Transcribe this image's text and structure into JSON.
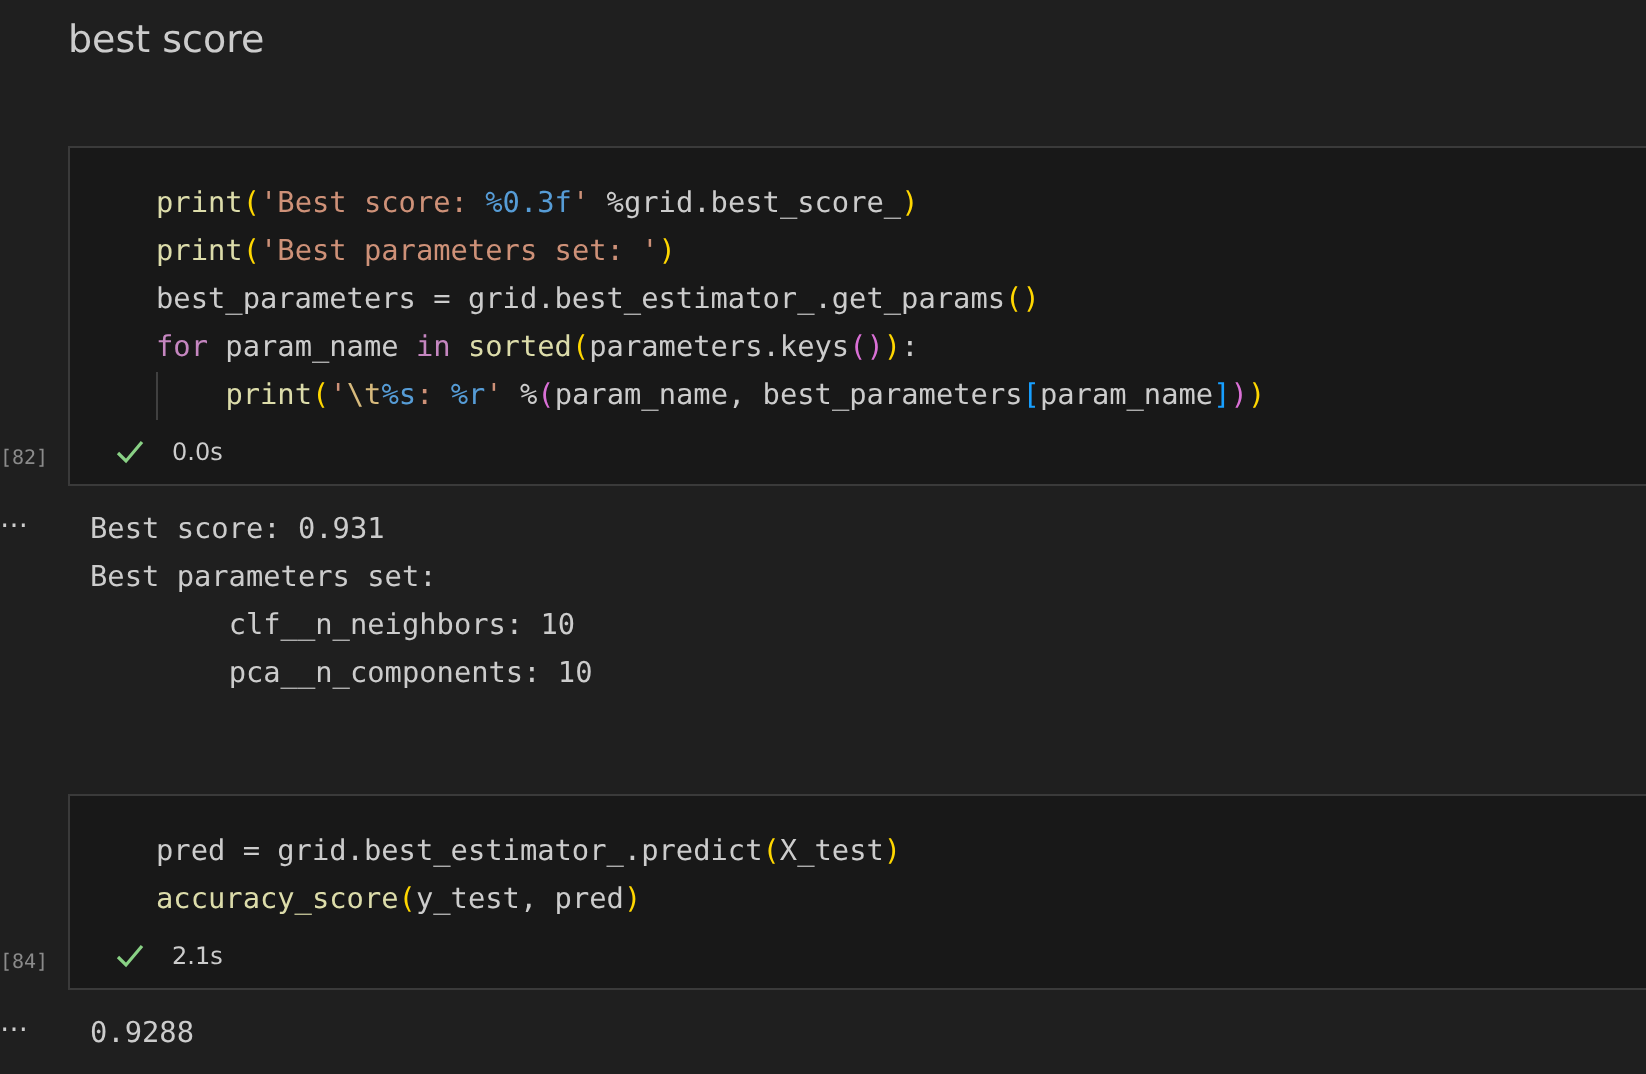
{
  "heading": "best score",
  "cells": [
    {
      "execution_count": "[82]",
      "succeeded": true,
      "duration": "0.0s",
      "output_menu": "⋯",
      "code": [
        {
          "indented": false,
          "tokens": [
            {
              "t": "print",
              "kind": "fn"
            },
            {
              "t": "(",
              "kind": "b1"
            },
            {
              "t": "'Best score: ",
              "kind": "str"
            },
            {
              "t": "%0.3f",
              "kind": "fmt"
            },
            {
              "t": "'",
              "kind": "str"
            },
            {
              "t": " %grid.best_score_",
              "kind": "p"
            },
            {
              "t": ")",
              "kind": "b1"
            }
          ]
        },
        {
          "indented": false,
          "tokens": [
            {
              "t": "print",
              "kind": "fn"
            },
            {
              "t": "(",
              "kind": "b1"
            },
            {
              "t": "'Best parameters set: '",
              "kind": "str"
            },
            {
              "t": ")",
              "kind": "b1"
            }
          ]
        },
        {
          "indented": false,
          "tokens": [
            {
              "t": "best_parameters = grid.best_estimator_.get_params",
              "kind": "p"
            },
            {
              "t": "()",
              "kind": "b1"
            }
          ]
        },
        {
          "indented": false,
          "tokens": [
            {
              "t": "for",
              "kind": "kw"
            },
            {
              "t": " param_name ",
              "kind": "p"
            },
            {
              "t": "in",
              "kind": "kw"
            },
            {
              "t": " sorted",
              "kind": "fn"
            },
            {
              "t": "(",
              "kind": "b1"
            },
            {
              "t": "parameters.keys",
              "kind": "p"
            },
            {
              "t": "()",
              "kind": "b2"
            },
            {
              "t": ")",
              "kind": "b1"
            },
            {
              "t": ":",
              "kind": "p"
            }
          ]
        },
        {
          "indented": true,
          "tokens": [
            {
              "t": "print",
              "kind": "fn"
            },
            {
              "t": "(",
              "kind": "b1"
            },
            {
              "t": "'",
              "kind": "str"
            },
            {
              "t": "\\t",
              "kind": "esc"
            },
            {
              "t": "%s",
              "kind": "fmt"
            },
            {
              "t": ": ",
              "kind": "str"
            },
            {
              "t": "%r",
              "kind": "fmt"
            },
            {
              "t": "'",
              "kind": "str"
            },
            {
              "t": " %",
              "kind": "p"
            },
            {
              "t": "(",
              "kind": "b2"
            },
            {
              "t": "param_name, best_parameters",
              "kind": "p"
            },
            {
              "t": "[",
              "kind": "b3"
            },
            {
              "t": "param_name",
              "kind": "p"
            },
            {
              "t": "]",
              "kind": "b3"
            },
            {
              "t": ")",
              "kind": "b2"
            },
            {
              "t": ")",
              "kind": "b1"
            }
          ]
        }
      ],
      "output": [
        "Best score: 0.931",
        "Best parameters set:",
        "\tclf__n_neighbors: 10",
        "\tpca__n_components: 10"
      ]
    },
    {
      "execution_count": "[84]",
      "succeeded": true,
      "duration": "2.1s",
      "output_menu": "⋯",
      "code": [
        {
          "indented": false,
          "tokens": [
            {
              "t": "pred = grid.best_estimator_.predict",
              "kind": "p"
            },
            {
              "t": "(",
              "kind": "b1"
            },
            {
              "t": "X_test",
              "kind": "p"
            },
            {
              "t": ")",
              "kind": "b1"
            }
          ]
        },
        {
          "indented": false,
          "tokens": [
            {
              "t": "accuracy_score",
              "kind": "fn"
            },
            {
              "t": "(",
              "kind": "b1"
            },
            {
              "t": "y_test, pred",
              "kind": "p"
            },
            {
              "t": ")",
              "kind": "b1"
            }
          ]
        }
      ],
      "output": [
        "0.9288"
      ]
    }
  ]
}
